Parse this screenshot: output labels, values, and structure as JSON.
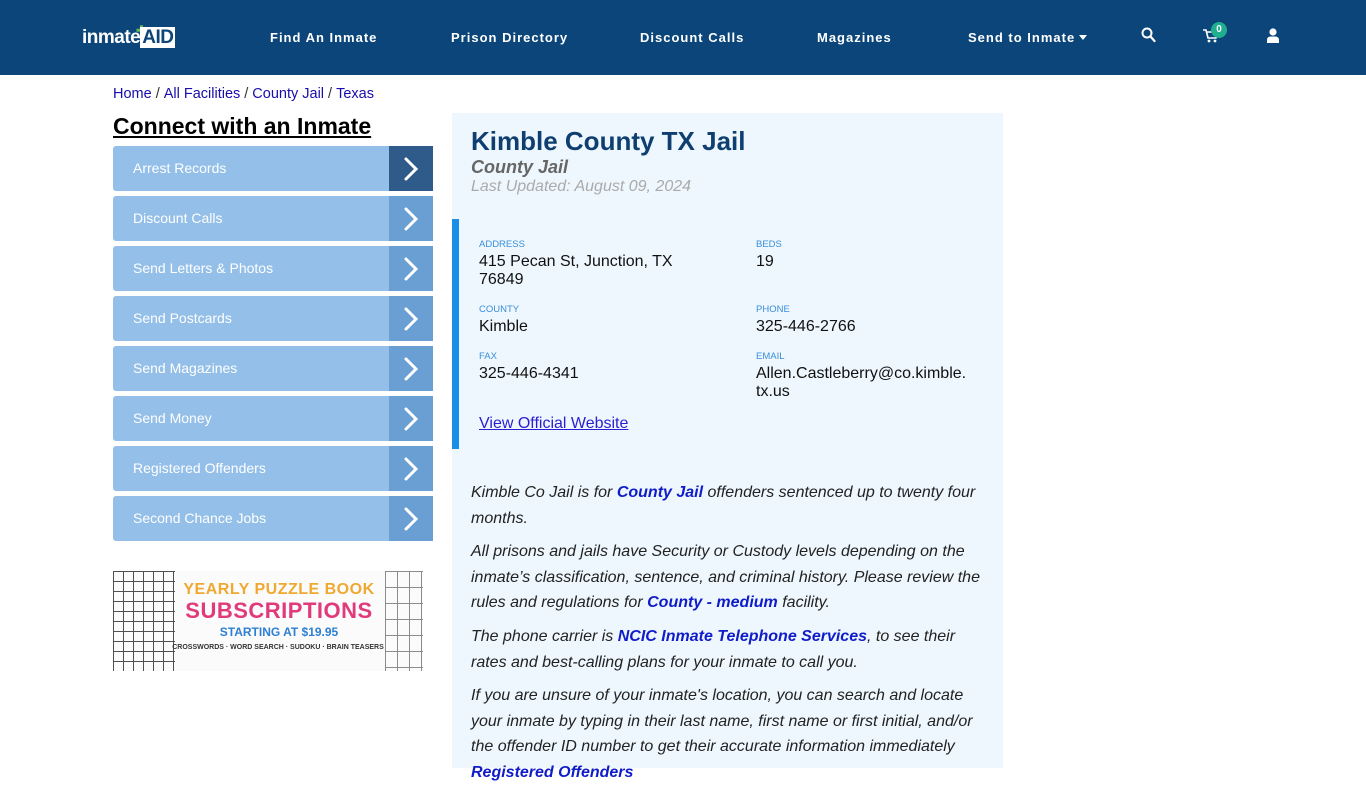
{
  "header": {
    "logo_text": "inmate",
    "logo_accent": "AID",
    "nav": [
      {
        "label": "Find An Inmate"
      },
      {
        "label": "Prison Directory"
      },
      {
        "label": "Discount Calls"
      },
      {
        "label": "Magazines"
      },
      {
        "label": "Send to Inmate"
      }
    ],
    "cart_count": "0",
    "icons": [
      "search-icon",
      "cart-icon",
      "user-icon"
    ]
  },
  "breadcrumb": [
    "Home",
    "All Facilities",
    "County Jail",
    "Texas"
  ],
  "sidebar": {
    "title": "Connect with an Inmate",
    "items": [
      {
        "label": "Arrest Records"
      },
      {
        "label": "Discount Calls"
      },
      {
        "label": "Send Letters & Photos"
      },
      {
        "label": "Send Postcards"
      },
      {
        "label": "Send Magazines"
      },
      {
        "label": "Send Money"
      },
      {
        "label": "Registered Offenders"
      },
      {
        "label": "Second Chance Jobs"
      }
    ],
    "ad": {
      "line1": "YEARLY PUZZLE BOOK",
      "line2": "SUBSCRIPTIONS",
      "line3": "STARTING AT $19.95",
      "line4": "CROSSWORDS · WORD SEARCH · SUDOKU · BRAIN TEASERS"
    }
  },
  "facility": {
    "title": "Kimble County TX Jail",
    "type": "County Jail",
    "updated": "Last Updated: August 09, 2024",
    "info": {
      "address_label": "ADDRESS",
      "address_line1": "415 Pecan St, Junction, TX",
      "address_line2": "76849",
      "beds_label": "BEDS",
      "beds": "19",
      "county_label": "COUNTY",
      "county": "Kimble",
      "phone_label": "PHONE",
      "phone": "325-446-2766",
      "fax_label": "FAX",
      "fax": "325-446-4341",
      "email_label": "EMAIL",
      "email_line1": "Allen.Castleberry@co.kimble.",
      "email_line2": "tx.us"
    },
    "official_link": "View Official Website",
    "paragraphs": {
      "p1_a": "Kimble Co Jail is for ",
      "p1_link": "County Jail",
      "p1_b": " offenders sentenced up to twenty four months.",
      "p2_a": "All prisons and jails have Security or Custody levels depending on the inmate’s classification, sentence, and criminal history. Please review the rules and regulations for ",
      "p2_link": "County - medium",
      "p2_b": " facility.",
      "p3_a": "The phone carrier is ",
      "p3_link": "NCIC Inmate Telephone Services",
      "p3_b": ", to see their rates and best-calling plans for your inmate to call you.",
      "p4_a": "If you are unsure of your inmate's location, you can search and locate your inmate by typing in their last name, first name or first initial, and/or the offender ID number to get their accurate information immediately ",
      "p4_link": "Registered Offenders"
    }
  }
}
